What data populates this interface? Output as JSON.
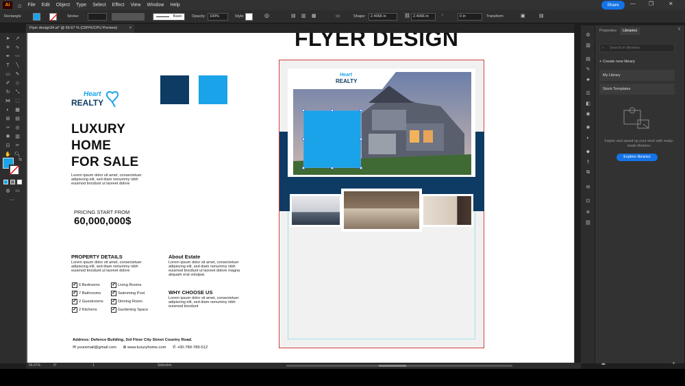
{
  "app": {
    "logo": "Ai",
    "menu": [
      "File",
      "Edit",
      "Object",
      "Type",
      "Select",
      "Effect",
      "View",
      "Window",
      "Help"
    ],
    "share_label": "Share",
    "colors": {
      "accent": "#1473e6",
      "blue": "#1aa3e8",
      "navy": "#0e3b63"
    }
  },
  "control": {
    "selection_type": "Rectangle",
    "stroke_label": "Stroke:",
    "brush_label": "Basic",
    "opacity_label": "Opacity:",
    "opacity_value": "100%",
    "style_label": "Style:",
    "shape_label": "Shape:",
    "width_value": "2.4066 in",
    "height_value": "2.4066 in",
    "angle_value": "0 in",
    "transform_label": "Transform"
  },
  "doc_tab": {
    "title": "Flyer design34.ai* @ 66.67 % (CMYK/CPU Preview)",
    "close": "×"
  },
  "status": {
    "zoom": "66.67%",
    "angle": "0°",
    "page": "1",
    "mode": "Selection"
  },
  "panel": {
    "tabs": [
      "Properties",
      "Libraries"
    ],
    "search_placeholder": "Search in libraries",
    "create_label": "Create new library",
    "libraries": [
      "My Library",
      "Stock Templates"
    ],
    "info": "Inspire and speed up your work with ready-made libraries.",
    "explore_label": "Explore libraries"
  },
  "flyer_left": {
    "logo_top": "Heart",
    "logo_bottom": "REALTY",
    "headline": [
      "LUXURY",
      "HOME",
      "FOR SALE"
    ],
    "intro": [
      "Lorem ipsum dolor sit amet, consectetuer",
      "adipiscing elit, sed diam nonummy nibh",
      "euismod tincidunt ut laoreet dolore"
    ],
    "pricing_label": "PRICING START FROM",
    "price": "60,000,000$",
    "details_title": "PROPERTY DETAILS",
    "details_text": [
      "Lorem ipsum dolor sit amet, consectetuer",
      "adipiscing elit, sed diam nonummy nibh",
      "euismod tincidunt ut laoreet dolore"
    ],
    "features_col1": [
      "6 Bedrooms",
      "7 Bathrooms",
      "2 Guestrooms",
      "2 Kitchens"
    ],
    "features_col2": [
      "Living Rooms",
      "Swimming Pool",
      "Dinning Room",
      "Gardening Space"
    ],
    "about_title": "About Estate",
    "about_text": [
      "Lorem ipsum dolor sit amet, consectetuer",
      "adipiscing elit, sed diam nonummy nibh",
      "euismod tincidunt ut laoreet dolore magna",
      "aliquam erat volutpat."
    ],
    "why_title": "WHY CHOOSE US",
    "why_text": [
      "Lorem ipsum dolor sit amet, consectetuer",
      "adipiscing elit, sed diam nonummy nibh",
      "euismod tincidunt"
    ],
    "address": "Address: Defence Building, 3rd Floor City Street Country Road.",
    "email": "youremail@gmail.com",
    "website": "www.luxuryhome.com",
    "phone": "+00-789-789-512"
  },
  "flyer_right": {
    "title": "FLYER DESIGN",
    "logo_top": "Heart",
    "logo_bottom": "REALTY"
  }
}
